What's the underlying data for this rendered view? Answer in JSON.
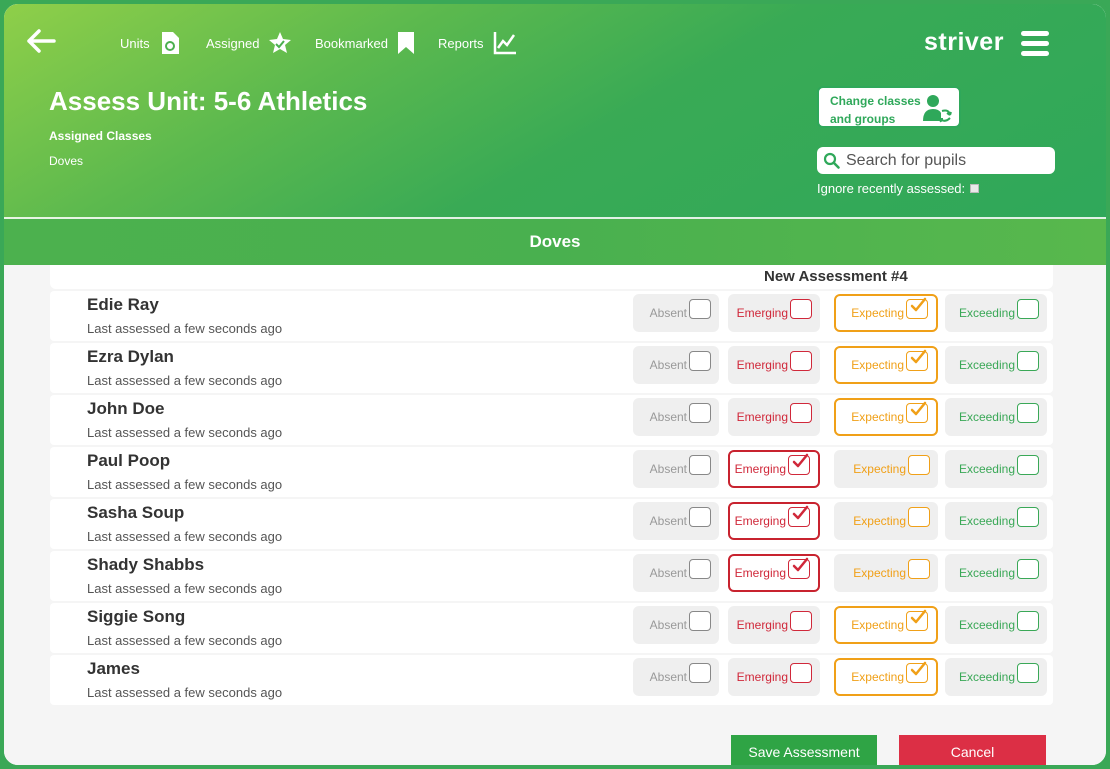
{
  "nav": {
    "back_icon": "arrow-left-icon",
    "items": [
      {
        "label": "Units",
        "icon": "units-icon"
      },
      {
        "label": "Assigned",
        "icon": "assigned-icon"
      },
      {
        "label": "Bookmarked",
        "icon": "bookmark-icon"
      },
      {
        "label": "Reports",
        "icon": "chart-icon"
      }
    ],
    "brand": "striver",
    "menu_icon": "hamburger-icon"
  },
  "header": {
    "title": "Assess Unit: 5-6 Athletics",
    "assigned_label": "Assigned Classes",
    "assigned_class": "Doves",
    "change_button_label": "Change classes and groups",
    "search_placeholder": "Search for pupils",
    "search_value": "",
    "ignore_label": "Ignore recently assessed:"
  },
  "class_bar": "Doves",
  "assessment_title": "New Assessment #4",
  "options": [
    "Absent",
    "Emerging",
    "Expecting",
    "Exceeding"
  ],
  "pupils": [
    {
      "name": "Edie Ray",
      "last": "Last assessed a few seconds ago",
      "selected": "Expecting"
    },
    {
      "name": "Ezra Dylan",
      "last": "Last assessed a few seconds ago",
      "selected": "Expecting"
    },
    {
      "name": "John Doe",
      "last": "Last assessed a few seconds ago",
      "selected": "Expecting"
    },
    {
      "name": "Paul Poop",
      "last": "Last assessed a few seconds ago",
      "selected": "Emerging"
    },
    {
      "name": "Sasha Soup",
      "last": "Last assessed a few seconds ago",
      "selected": "Emerging"
    },
    {
      "name": "Shady Shabbs",
      "last": "Last assessed a few seconds ago",
      "selected": "Emerging"
    },
    {
      "name": "Siggie Song",
      "last": "Last assessed a few seconds ago",
      "selected": "Expecting"
    },
    {
      "name": "James",
      "last": "Last assessed a few seconds ago",
      "selected": "Expecting"
    }
  ],
  "footer": {
    "save_label": "Save Assessment",
    "cancel_label": "Cancel"
  },
  "colors": {
    "brand_green": "#2fa85a",
    "emerging_red": "#d0283a",
    "expecting_orange": "#f0a018",
    "exceeding_green": "#3aa857",
    "absent_grey": "#999999"
  }
}
